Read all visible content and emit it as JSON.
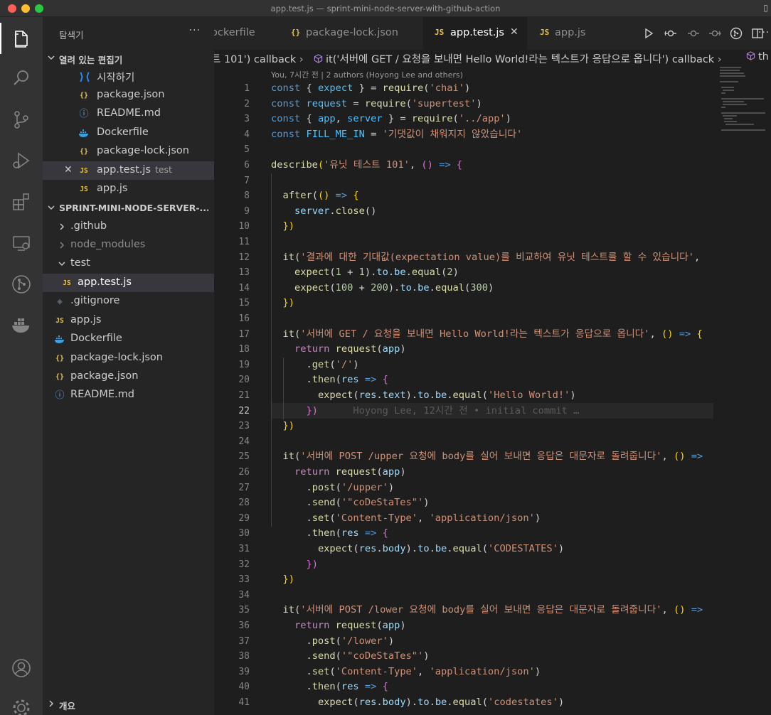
{
  "window": {
    "title": "app.test.js — sprint-mini-node-server-with-github-action"
  },
  "sidebar": {
    "title": "탐색기",
    "more": "···",
    "open_editors_label": "열려 있는 편집기",
    "open_editors": [
      {
        "name": "시작하기",
        "icon": "vscode-icon"
      },
      {
        "name": "package.json",
        "icon": "json-icon"
      },
      {
        "name": "README.md",
        "icon": "info-icon"
      },
      {
        "name": "Dockerfile",
        "icon": "docker-icon"
      },
      {
        "name": "package-lock.json",
        "icon": "json-icon"
      },
      {
        "name": "app.test.js",
        "icon": "js-icon",
        "description": "test",
        "selected": true
      },
      {
        "name": "app.js",
        "icon": "js-icon"
      }
    ],
    "project_label": "SPRINT-MINI-NODE-SERVER-...",
    "tree": [
      {
        "name": ".github",
        "type": "folder"
      },
      {
        "name": "node_modules",
        "type": "folder",
        "dimmed": true
      },
      {
        "name": "test",
        "type": "folder",
        "expanded": true
      },
      {
        "name": "app.test.js",
        "type": "file",
        "icon": "js-icon",
        "selected": true
      },
      {
        "name": ".gitignore",
        "type": "file",
        "icon": "git-icon"
      },
      {
        "name": "app.js",
        "type": "file",
        "icon": "js-icon"
      },
      {
        "name": "Dockerfile",
        "type": "file",
        "icon": "docker-icon"
      },
      {
        "name": "package-lock.json",
        "type": "file",
        "icon": "json-icon"
      },
      {
        "name": "package.json",
        "type": "file",
        "icon": "json-icon"
      },
      {
        "name": "README.md",
        "type": "file",
        "icon": "info-icon"
      }
    ],
    "outline_label": "개요"
  },
  "tabs": [
    {
      "label": "ockerfile",
      "icon": ""
    },
    {
      "label": "package-lock.json",
      "icon": "{}"
    },
    {
      "label": "app.test.js",
      "icon": "JS",
      "active": true
    },
    {
      "label": "app.js",
      "icon": "JS"
    }
  ],
  "icons": {
    "js": "JS",
    "json": "{}",
    "info": "ⓘ",
    "git": "◈",
    "close": "✕",
    "more": "···"
  },
  "breadcrumb": {
    "part1": "트 101') callback",
    "part2": "it('서버에 GET / 요청을 보내면 Hello World!라는 텍스트가 응답으로 옵니다') callback",
    "part3": "th"
  },
  "editor": {
    "blame_header": "You, 7시간 전 | 2 authors (Hoyong Lee and others)",
    "current_line": 22,
    "inline_blame": "Hoyong Lee, 12시간 전 • initial commit …",
    "line_numbers": [
      "1",
      "2",
      "3",
      "4",
      "5",
      "6",
      "7",
      "8",
      "9",
      "10",
      "11",
      "12",
      "13",
      "14",
      "15",
      "16",
      "17",
      "18",
      "19",
      "20",
      "21",
      "22",
      "23",
      "24",
      "25",
      "26",
      "27",
      "28",
      "29",
      "30",
      "31",
      "32",
      "33",
      "34",
      "35",
      "36",
      "37",
      "38",
      "39",
      "40",
      "41"
    ],
    "code": {
      "l12_str": "'결과에 대한 기대값(expectation value)를 비교하여 유닛 테스트를 할 수 있습니다'",
      "l17_str": "'서버에 GET / 요청을 보내면 Hello World!라는 텍스트가 응답으로 옵니다'",
      "l25_str": "'서버에 POST /upper 요청에 body를 실어 보내면 응답은 대문자로 돌려줍니다'",
      "l35_str": "'서버에 POST /lower 요청에 body를 실어 보내면 응답은 대문자로 돌려줍니다'",
      "l4_str": "'기댓값이 채워지지 않았습니다'",
      "l6_str": "'유닛 테스트 101'"
    }
  },
  "colors": {
    "accent": "#007acc",
    "editor_bg": "#1e1e1e",
    "sidebar_bg": "#252526",
    "activity_bg": "#333333"
  }
}
